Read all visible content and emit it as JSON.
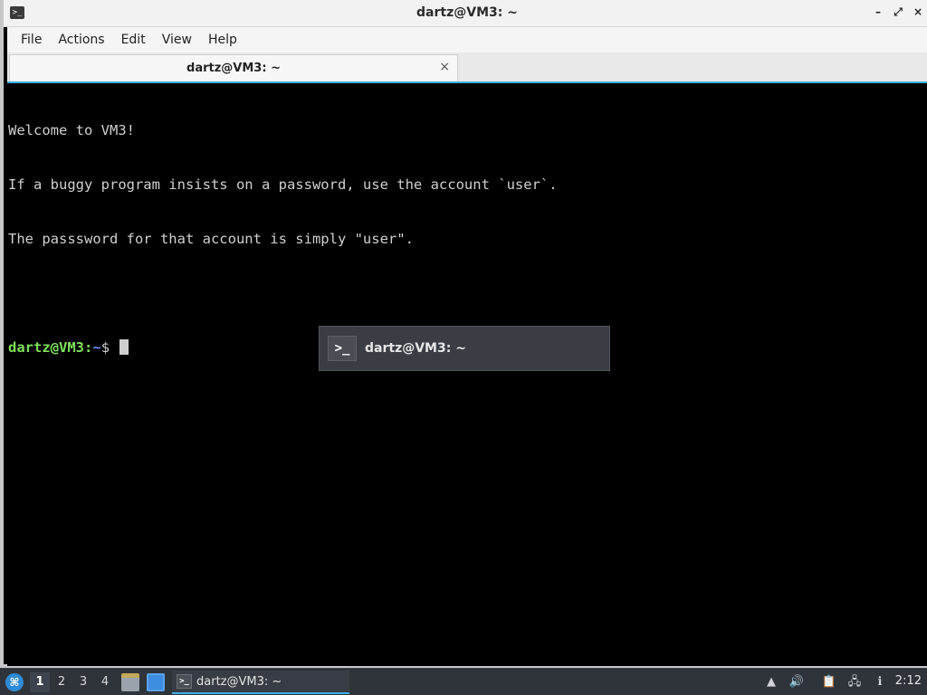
{
  "window": {
    "title": "dartz@VM3: ~",
    "controls": {
      "minimize": "–",
      "restore": "⤢",
      "close": "×"
    }
  },
  "menu": [
    "File",
    "Actions",
    "Edit",
    "View",
    "Help"
  ],
  "tab": {
    "label": "dartz@VM3: ~",
    "close": "×"
  },
  "terminal": {
    "lines": [
      "Welcome to VM3!",
      "If a buggy program insists on a password, use the account `user`.",
      "The passsword for that account is simply \"user\".",
      ""
    ],
    "prompt_user": "dartz@VM3",
    "prompt_sep": ":",
    "prompt_path": "~",
    "prompt_symbol": "$ "
  },
  "switcher": {
    "label": "dartz@VM3: ~",
    "icon": "terminal-icon"
  },
  "taskbar": {
    "desktops": [
      "1",
      "2",
      "3",
      "4"
    ],
    "active_desktop": "1",
    "task_label": "dartz@VM3: ~",
    "clock": "2:12",
    "accent": "#3daee9"
  }
}
